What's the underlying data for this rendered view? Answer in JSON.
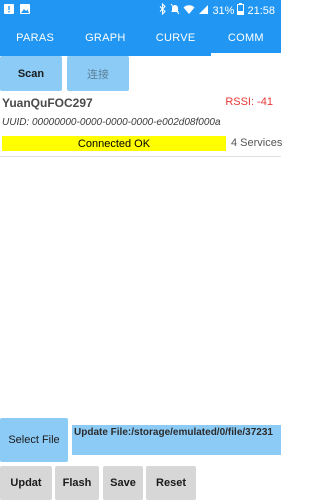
{
  "status_bar": {
    "battery": "31%",
    "time": "21:58",
    "icons": [
      "sim-alert-icon",
      "image-icon",
      "bluetooth-icon",
      "silent-icon",
      "wifi-icon",
      "signal-icon",
      "battery-icon"
    ]
  },
  "tabs": [
    {
      "label": "PARAS"
    },
    {
      "label": "GRAPH"
    },
    {
      "label": "CURVE"
    },
    {
      "label": "COMM",
      "active": true
    }
  ],
  "buttons": {
    "scan": "Scan",
    "connect": "连接",
    "select_file": "Select File",
    "update": "Updat",
    "flash": "Flash",
    "save": "Save",
    "reset": "Reset"
  },
  "device": {
    "name": "YuanQuFOC297",
    "rssi": "RSSI: -41",
    "uuid": "UUID: 00000000-0000-0000-0000-e002d08f000a",
    "status": "Connected OK",
    "services": "4 Services"
  },
  "update_file": {
    "path": "Update File:/storage/emulated/0/file/37231"
  },
  "colors": {
    "primary": "#2196f3",
    "button": "#8ccbf6",
    "status_ok": "#ffff00",
    "rssi": "#e53935",
    "bottom_button": "#d7d7d7"
  }
}
